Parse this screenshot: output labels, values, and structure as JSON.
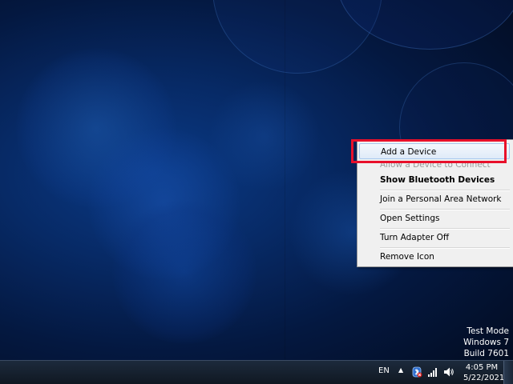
{
  "context_menu": {
    "items": [
      {
        "label": "Add a Device",
        "state": "highlighted"
      },
      {
        "label": "Allow a Device to Connect",
        "state": "disabled"
      },
      {
        "label": "Show Bluetooth Devices",
        "state": "default-bold"
      },
      {
        "label": "Join a Personal Area Network",
        "state": "normal"
      },
      {
        "label": "Open Settings",
        "state": "normal"
      },
      {
        "label": "Turn Adapter Off",
        "state": "normal"
      },
      {
        "label": "Remove Icon",
        "state": "normal"
      }
    ]
  },
  "watermark": {
    "line1": "Test Mode",
    "line2": "Windows 7",
    "line3": "Build 7601"
  },
  "taskbar": {
    "language": "EN",
    "tray_arrow": "▲",
    "time": "4:05 PM",
    "date": "5/22/2021",
    "tray_icons": [
      "bluetooth-icon",
      "network-signal-icon",
      "volume-icon"
    ]
  },
  "colors": {
    "highlight_border": "#e8102a",
    "menu_background": "#f0f0f0",
    "taskbar": "#141e2c"
  }
}
